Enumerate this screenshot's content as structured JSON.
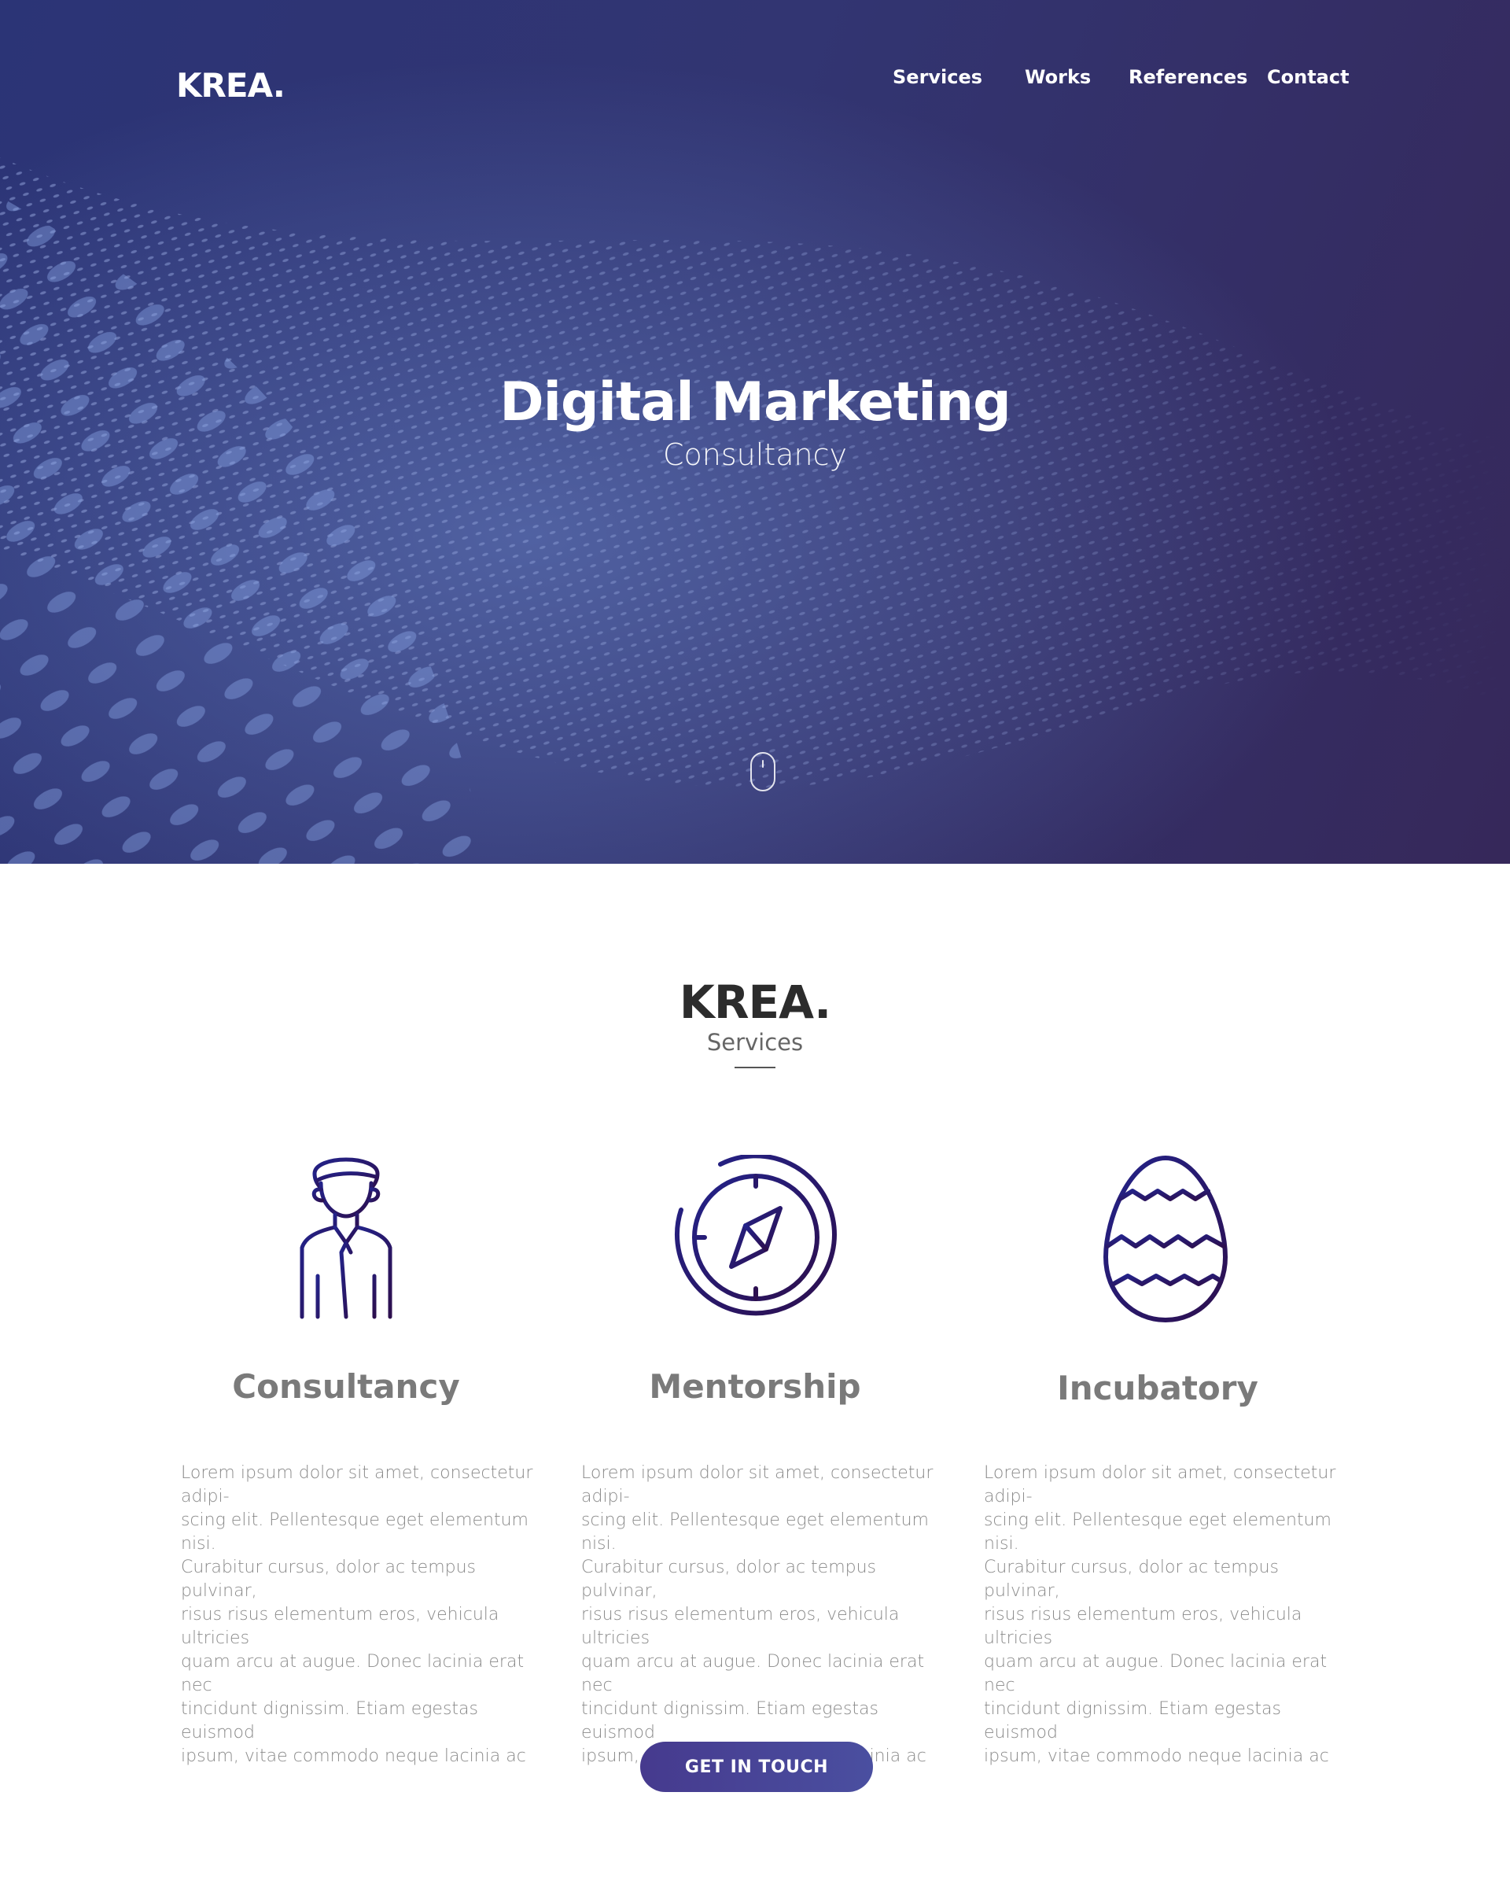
{
  "header": {
    "logo": "KREA.",
    "nav": [
      "Services",
      "Works",
      "References",
      "Contact"
    ]
  },
  "hero": {
    "title": "Digital Marketing",
    "subtitle": "Consultancy",
    "scroll_icon": "mouse-scroll-icon"
  },
  "services": {
    "logo": "KREA.",
    "subtitle": "Services",
    "cards": [
      {
        "icon": "person-icon",
        "title": "Consultancy",
        "text": "Lorem ipsum dolor sit amet, consectetur adipi-\nscing elit. Pellentesque eget elementum nisi.\nCurabitur cursus, dolor ac tempus pulvinar,\nrisus risus elementum eros, vehicula ultricies\nquam arcu at augue. Donec lacinia erat nec\ntincidunt dignissim. Etiam egestas euismod\nipsum, vitae commodo neque lacinia ac"
      },
      {
        "icon": "compass-icon",
        "title": "Mentorship",
        "text": "Lorem ipsum dolor sit amet, consectetur adipi-\nscing elit. Pellentesque eget elementum nisi.\nCurabitur cursus, dolor ac tempus pulvinar,\nrisus risus elementum eros, vehicula ultricies\nquam arcu at augue. Donec lacinia erat nec\ntincidunt dignissim. Etiam egestas euismod\nipsum, vitae commodo neque lacinia ac"
      },
      {
        "icon": "egg-icon",
        "title": "Incubatory",
        "text": "Lorem ipsum dolor sit amet, consectetur adipi-\nscing elit. Pellentesque eget elementum nisi.\nCurabitur cursus, dolor ac tempus pulvinar,\nrisus risus elementum eros, vehicula ultricies\nquam arcu at augue. Donec lacinia erat nec\ntincidunt dignissim. Etiam egestas euismod\nipsum, vitae commodo neque lacinia ac"
      }
    ],
    "cta": "GET IN TOUCH"
  },
  "colors": {
    "hero_start": "#2b3476",
    "hero_end": "#36285a",
    "icon_start": "#23238a",
    "icon_end": "#2d0f4e",
    "button": "#463a8e"
  }
}
